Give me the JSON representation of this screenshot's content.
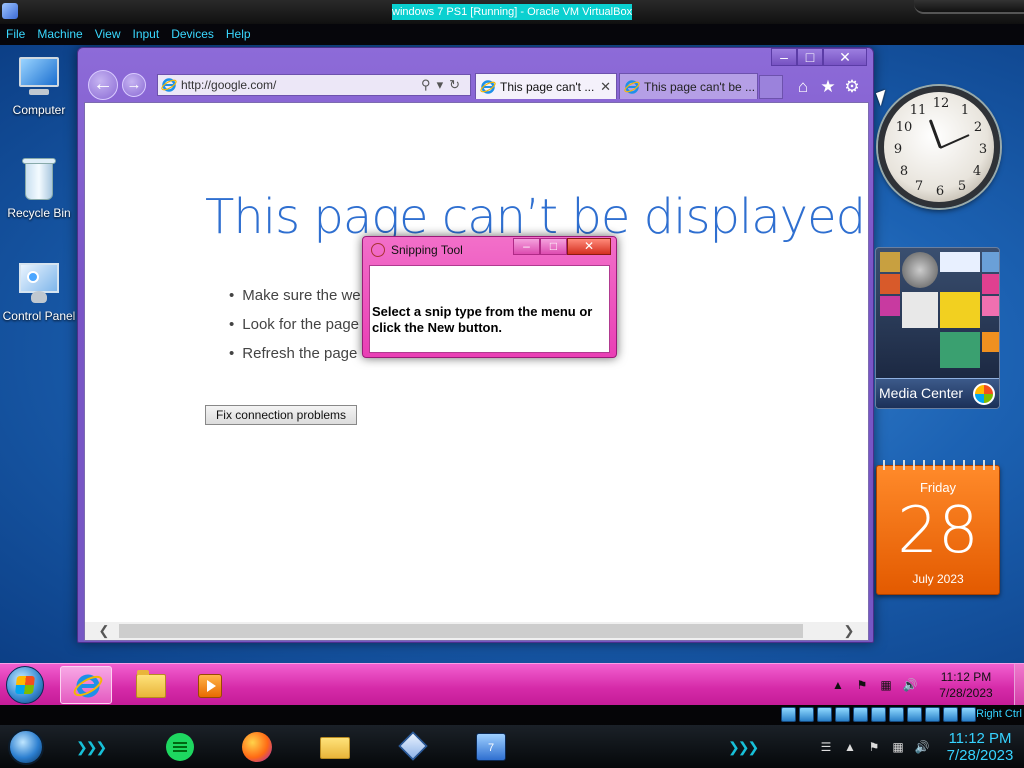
{
  "host": {
    "title": "windows 7 PS1 [Running] - Oracle VM VirtualBox",
    "menu": [
      "File",
      "Machine",
      "View",
      "Input",
      "Devices",
      "Help"
    ],
    "status_right": "Right Ctrl",
    "taskbar": {
      "time": "11:12 PM",
      "date": "7/28/2023",
      "apps": [
        "spotify-icon",
        "firefox-icon",
        "folder-icon",
        "virtualbox-icon",
        "vm-window-icon"
      ],
      "vm_badge": "7"
    }
  },
  "desktop": {
    "icons": [
      {
        "label": "Computer",
        "icon": "computer-icon"
      },
      {
        "label": "Recycle Bin",
        "icon": "recycle-bin-icon"
      },
      {
        "label": "Control Panel",
        "icon": "control-panel-icon"
      }
    ]
  },
  "browser": {
    "url": "http://google.com/",
    "tabs": [
      {
        "title": "This page can't ...",
        "active": true
      },
      {
        "title": "This page can't be ...",
        "active": false
      }
    ],
    "error_title": "This page can’t be displayed",
    "error_items": [
      "Make sure the we",
      "Look for the page",
      "Refresh the page"
    ],
    "fix_button": "Fix connection problems"
  },
  "snipping_tool": {
    "title": "Snipping Tool",
    "message": "Select a snip type from the menu or click the New button."
  },
  "gadgets": {
    "clock_numbers": [
      "12",
      "1",
      "2",
      "3",
      "4",
      "5",
      "6",
      "7",
      "8",
      "9",
      "10",
      "11"
    ],
    "media_center_label": "Media Center",
    "calendar": {
      "day": "Friday",
      "date": "28",
      "month_year": "July 2023"
    }
  },
  "guest_taskbar": {
    "time": "11:12 PM",
    "date": "7/28/2023"
  },
  "colors": {
    "guest_taskbar": "#d52aa8",
    "ie_frame": "#7a55c7",
    "error_title": "#2f6fd0",
    "calendar": "#e35a00",
    "host_accent": "#36d3ff"
  }
}
